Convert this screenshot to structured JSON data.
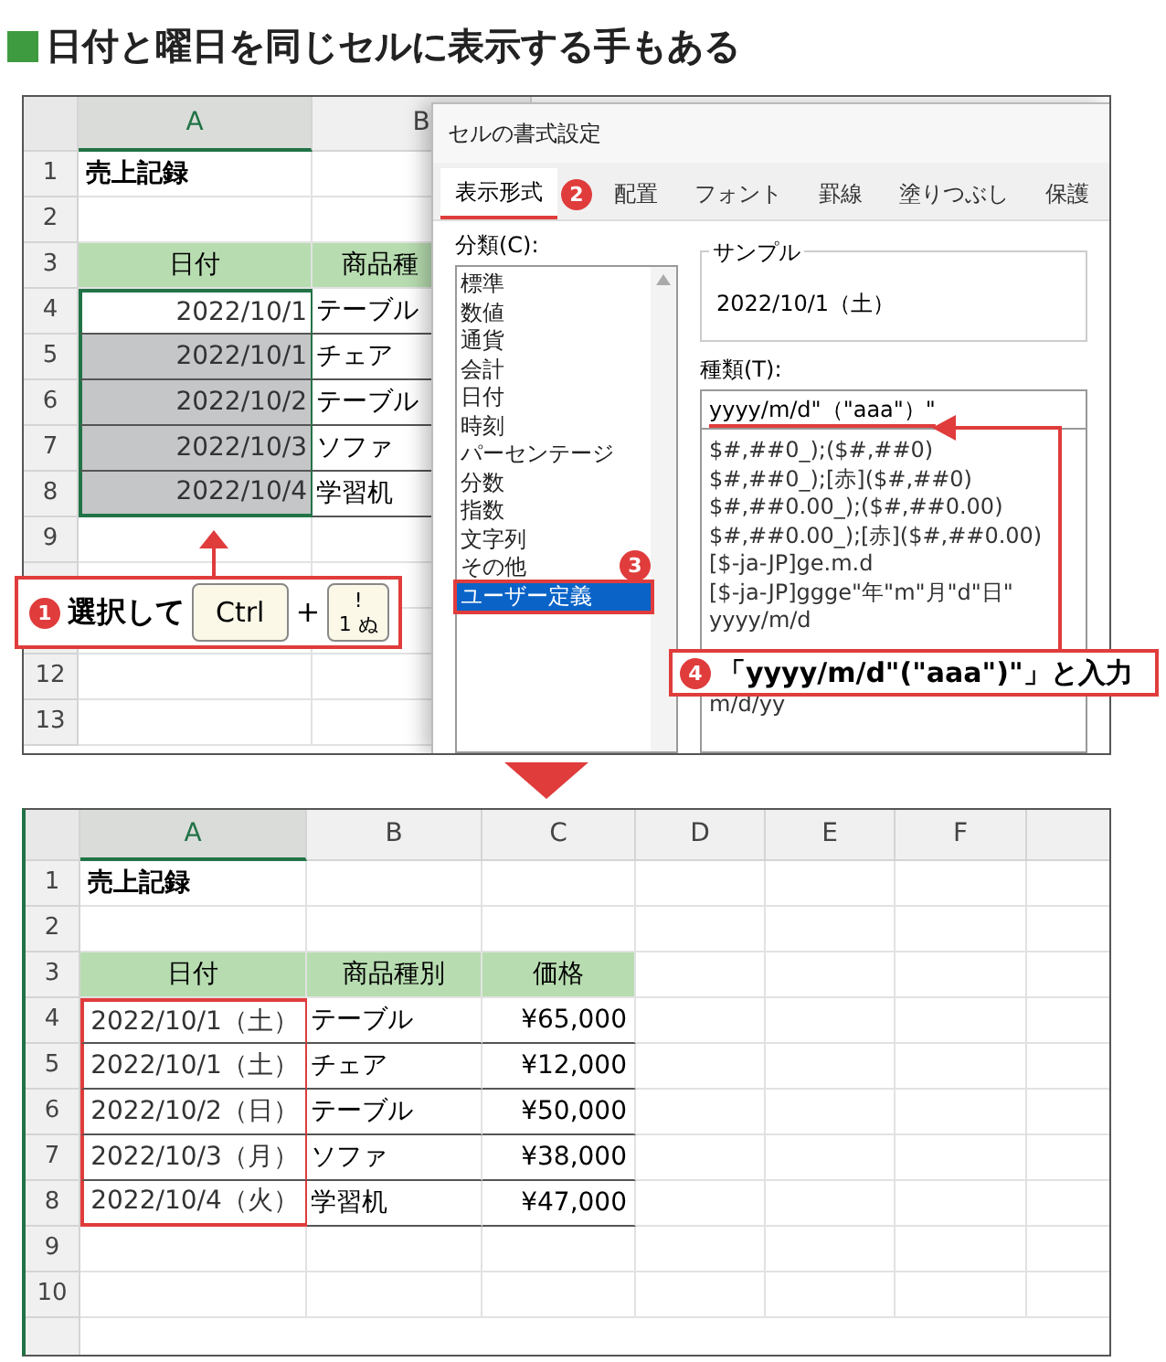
{
  "heading": "日付と曜日を同じセルに表示する手もある",
  "before_sheet": {
    "columns": [
      {
        "label": "A",
        "selected": true
      },
      {
        "label": "B",
        "selected": false
      }
    ],
    "rows": [
      {
        "number": "1",
        "kind": "title",
        "text": "売上記録"
      },
      {
        "number": "2",
        "kind": "blank"
      },
      {
        "number": "3",
        "kind": "header",
        "cells": [
          "日付",
          "商品種"
        ]
      },
      {
        "number": "4",
        "kind": "data",
        "date": "2022/10/1",
        "item": "テーブル",
        "selected": true,
        "active": true
      },
      {
        "number": "5",
        "kind": "data",
        "date": "2022/10/1",
        "item": "チェア",
        "selected": true,
        "active": false
      },
      {
        "number": "6",
        "kind": "data",
        "date": "2022/10/2",
        "item": "テーブル",
        "selected": true,
        "active": false
      },
      {
        "number": "7",
        "kind": "data",
        "date": "2022/10/3",
        "item": "ソファ",
        "selected": true,
        "active": false
      },
      {
        "number": "8",
        "kind": "data",
        "date": "2022/10/4",
        "item": "学習机",
        "selected": true,
        "active": false
      },
      {
        "number": "9",
        "kind": "blank"
      },
      {
        "kind": "blank"
      },
      {
        "kind": "blank"
      },
      {
        "number": "12",
        "kind": "blank"
      },
      {
        "number": "13",
        "kind": "blank"
      }
    ]
  },
  "dialog": {
    "title": "セルの書式設定",
    "tabs": [
      {
        "label": "表示形式",
        "selected": true,
        "badge": "2"
      },
      {
        "label": "配置",
        "selected": false
      },
      {
        "label": "フォント",
        "selected": false
      },
      {
        "label": "罫線",
        "selected": false
      },
      {
        "label": "塗りつぶし",
        "selected": false
      },
      {
        "label": "保護",
        "selected": false
      }
    ],
    "category_label": "分類(C):",
    "categories": [
      {
        "label": "標準",
        "selected": false
      },
      {
        "label": "数値",
        "selected": false
      },
      {
        "label": "通貨",
        "selected": false
      },
      {
        "label": "会計",
        "selected": false
      },
      {
        "label": "日付",
        "selected": false
      },
      {
        "label": "時刻",
        "selected": false
      },
      {
        "label": "パーセンテージ",
        "selected": false
      },
      {
        "label": "分数",
        "selected": false
      },
      {
        "label": "指数",
        "selected": false
      },
      {
        "label": "文字列",
        "selected": false
      },
      {
        "label": "その他",
        "selected": false
      },
      {
        "label": "ユーザー定義",
        "selected": true,
        "badge": "3"
      }
    ],
    "sample_label": "サンプル",
    "sample_value": "2022/10/1（土）",
    "type_label": "種類(T):",
    "type_value": "yyyy/m/d\"（\"aaa\"）\"",
    "formats": [
      "$#,##0_);($#,##0)",
      "$#,##0_);[赤]($#,##0)",
      "$#,##0.00_);($#,##0.00)",
      "$#,##0.00_);[赤]($#,##0.00)",
      "[$-ja-JP]ge.m.d",
      "[$-ja-JP]ggge\"年\"m\"月\"d\"日\"",
      "yyyy/m/d"
    ],
    "formats_below_callout": [
      "m/d/yy"
    ]
  },
  "step1": {
    "number": "1",
    "text": "選択して",
    "plus": "+",
    "keys": [
      {
        "kind": "text",
        "label": "Ctrl"
      },
      {
        "kind": "stack",
        "top": "!",
        "bottom": "1 ぬ"
      }
    ]
  },
  "step4": {
    "number": "4",
    "text": "「yyyy/m/d\"(\"aaa\")\"」と入力"
  },
  "after_sheet": {
    "columns": [
      {
        "label": "A",
        "selected": true
      },
      {
        "label": "B",
        "selected": false
      },
      {
        "label": "C",
        "selected": false
      },
      {
        "label": "D",
        "selected": false
      },
      {
        "label": "E",
        "selected": false
      },
      {
        "label": "F",
        "selected": false
      }
    ],
    "rows": [
      {
        "number": "1",
        "kind": "title",
        "text": "売上記録"
      },
      {
        "number": "2",
        "kind": "blank"
      },
      {
        "number": "3",
        "kind": "header",
        "cells": [
          "日付",
          "商品種別",
          "価格"
        ]
      },
      {
        "number": "4",
        "kind": "data",
        "date": "2022/10/1（土）",
        "item": "テーブル",
        "price": "¥65,000",
        "outlined": true
      },
      {
        "number": "5",
        "kind": "data",
        "date": "2022/10/1（土）",
        "item": "チェア",
        "price": "¥12,000",
        "outlined": true
      },
      {
        "number": "6",
        "kind": "data",
        "date": "2022/10/2（日）",
        "item": "テーブル",
        "price": "¥50,000",
        "outlined": true
      },
      {
        "number": "7",
        "kind": "data",
        "date": "2022/10/3（月）",
        "item": "ソファ",
        "price": "¥38,000",
        "outlined": true
      },
      {
        "number": "8",
        "kind": "data",
        "date": "2022/10/4（火）",
        "item": "学習机",
        "price": "¥47,000",
        "outlined": true
      },
      {
        "number": "9",
        "kind": "blank"
      },
      {
        "number": "10",
        "kind": "blank"
      }
    ]
  }
}
